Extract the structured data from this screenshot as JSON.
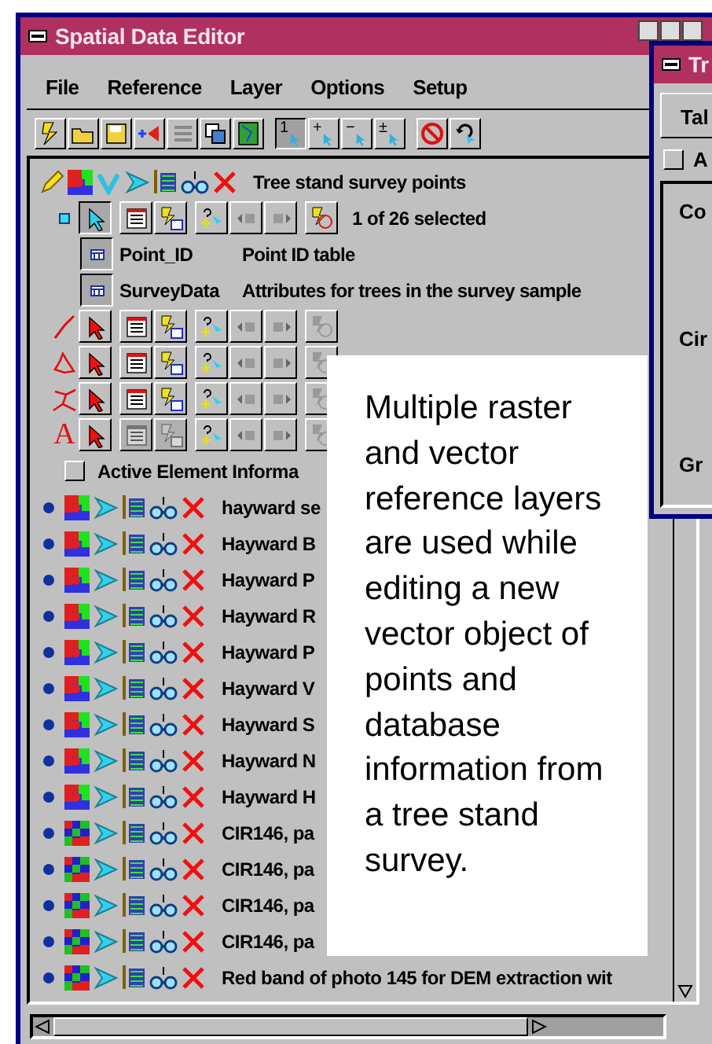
{
  "window": {
    "title": "Spatial Data Editor"
  },
  "menu": [
    "File",
    "Reference",
    "Layer",
    "Options",
    "Setup"
  ],
  "toolbar_modes": [
    {
      "label": "1",
      "selected": true
    },
    {
      "label": "+",
      "selected": false
    },
    {
      "label": "−",
      "selected": false
    },
    {
      "label": "±",
      "selected": false
    }
  ],
  "vector_layer": {
    "name": "Tree stand survey points",
    "editing": true,
    "selection": "1 of 26 selected",
    "tables": [
      {
        "name": "Point_ID",
        "description": "Point ID table"
      },
      {
        "name": "SurveyData",
        "description": "Attributes for trees in the survey sample"
      }
    ],
    "elements": [
      {
        "kind": "point",
        "selected": true,
        "disabled": false
      },
      {
        "kind": "line",
        "selected": false,
        "disabled": false
      },
      {
        "kind": "polygon",
        "selected": false,
        "disabled": false
      },
      {
        "kind": "node",
        "selected": false,
        "disabled": false
      },
      {
        "kind": "label",
        "symbol": "A",
        "selected": false,
        "disabled": true
      }
    ]
  },
  "active_element_info": {
    "label": "Active Element Informa",
    "checked": false
  },
  "raster_layers": [
    {
      "name": "hayward se",
      "kind": "photo"
    },
    {
      "name": "Hayward B",
      "kind": "photo"
    },
    {
      "name": "Hayward P",
      "kind": "photo"
    },
    {
      "name": "Hayward R",
      "kind": "photo"
    },
    {
      "name": "Hayward P",
      "kind": "photo"
    },
    {
      "name": "Hayward V",
      "kind": "photo"
    },
    {
      "name": "Hayward S",
      "kind": "photo"
    },
    {
      "name": "Hayward N",
      "kind": "photo"
    },
    {
      "name": "Hayward H",
      "kind": "photo"
    },
    {
      "name": "CIR146, pa",
      "kind": "composite"
    },
    {
      "name": "CIR146, pa",
      "kind": "composite"
    },
    {
      "name": "CIR146, pa",
      "kind": "composite"
    },
    {
      "name": "CIR146, pa",
      "kind": "composite"
    },
    {
      "name": "Red band of photo 145 for DEM extraction wit",
      "kind": "composite"
    }
  ],
  "callout": "Multiple raster and vector reference layers are used while editing a new vector object of points and database information from a tree stand survey.",
  "second_window": {
    "title": "Tr",
    "tab": "Tal",
    "checkbox": {
      "label": "A",
      "checked": false
    },
    "labels": [
      "Co",
      "Cir",
      "Gr"
    ]
  }
}
